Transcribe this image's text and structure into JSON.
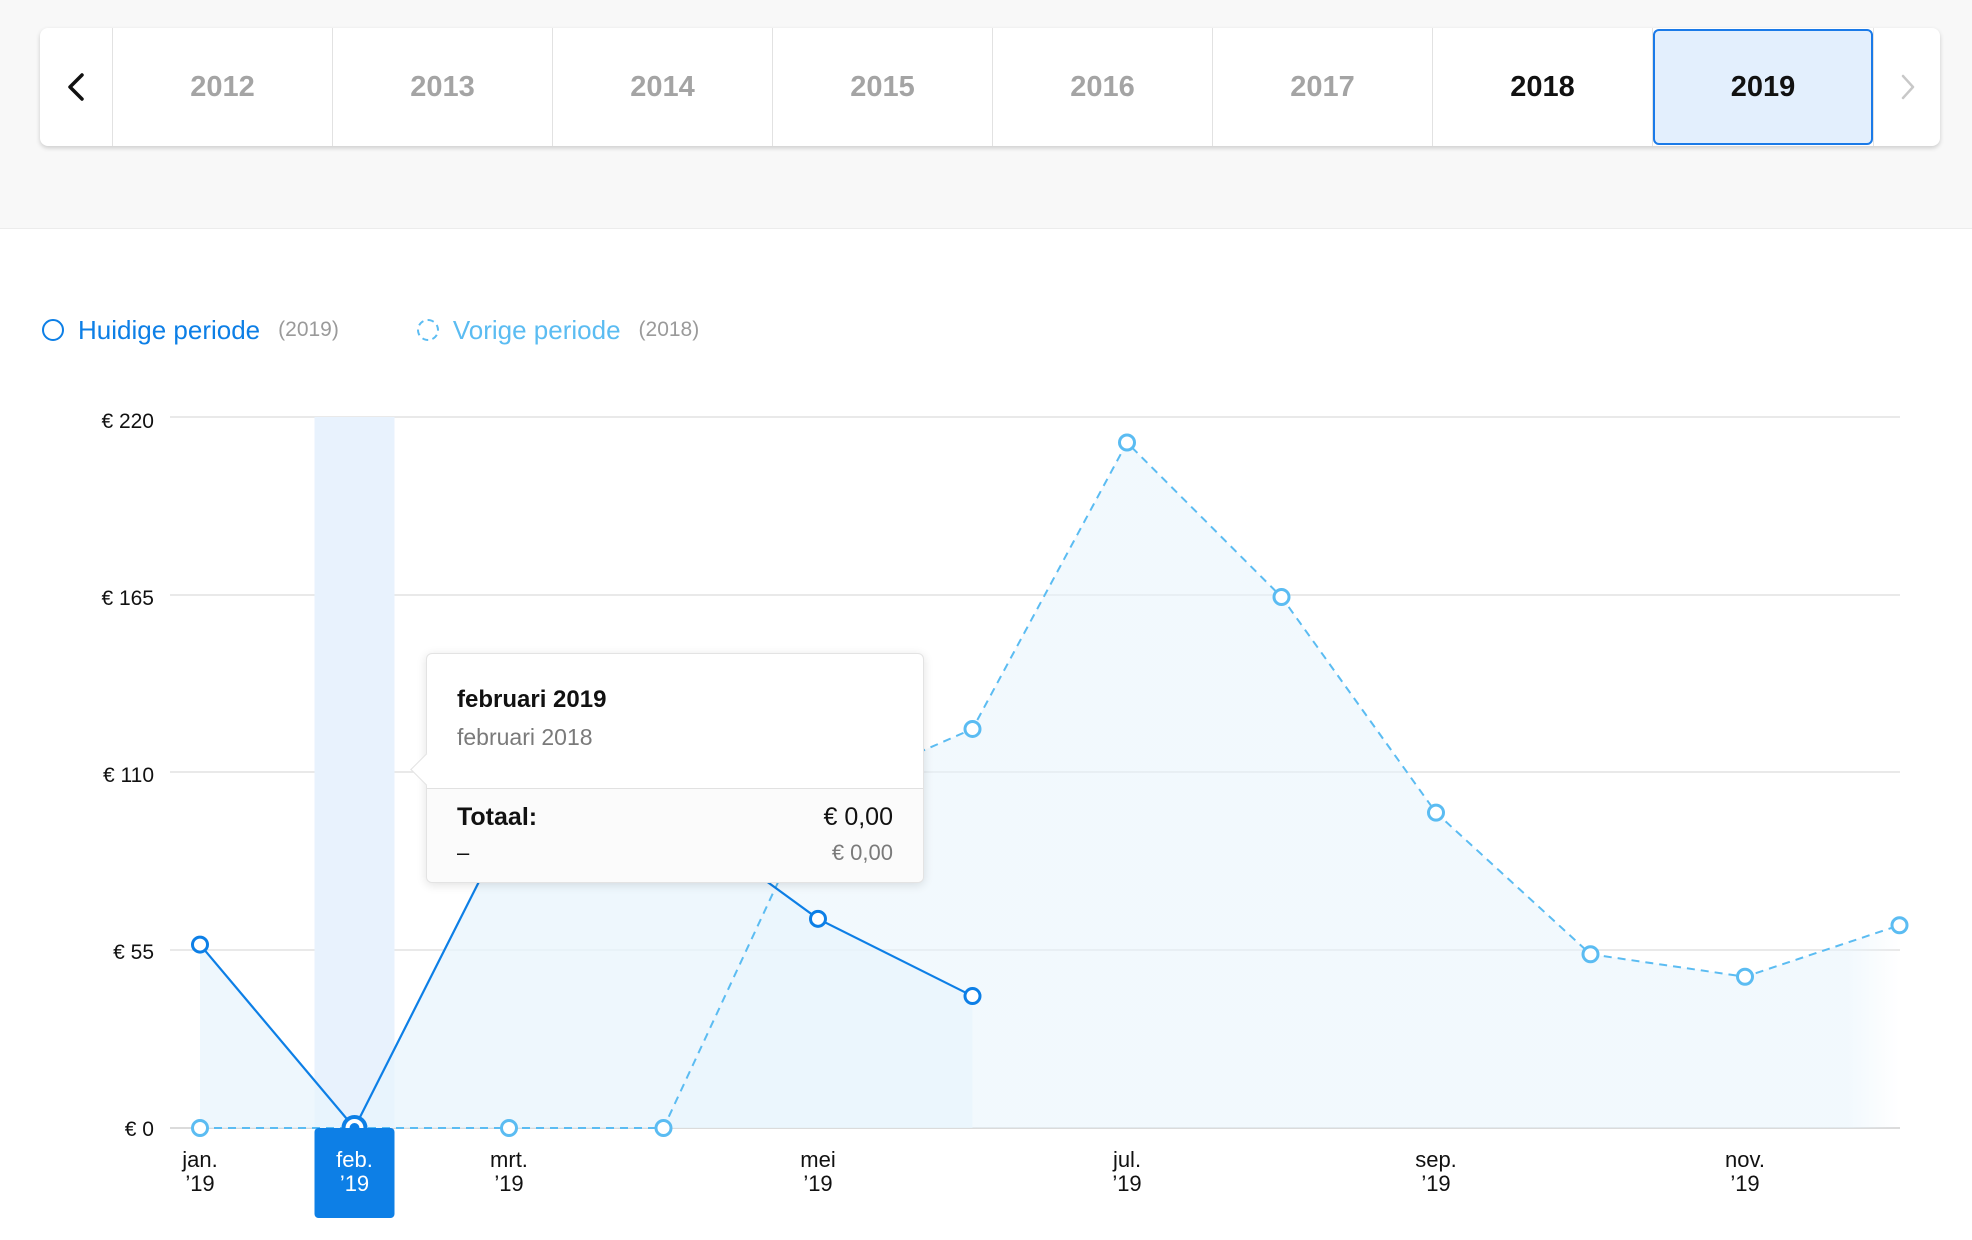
{
  "year_selector": {
    "prev_icon": "chevron-left-icon",
    "next_icon": "chevron-right-icon",
    "years": [
      {
        "label": "2012",
        "state": "dim"
      },
      {
        "label": "2013",
        "state": "dim"
      },
      {
        "label": "2014",
        "state": "dim"
      },
      {
        "label": "2015",
        "state": "dim"
      },
      {
        "label": "2016",
        "state": "dim"
      },
      {
        "label": "2017",
        "state": "dim"
      },
      {
        "label": "2018",
        "state": "bold"
      },
      {
        "label": "2019",
        "state": "selected"
      }
    ]
  },
  "legend": {
    "current": {
      "label": "Huidige periode",
      "year": "(2019)",
      "color": "#0d7fe6"
    },
    "previous": {
      "label": "Vorige periode",
      "year": "(2018)",
      "color": "#5bbcf2"
    }
  },
  "tooltip": {
    "title": "februari 2019",
    "subtitle": "februari 2018",
    "total_label": "Totaal:",
    "total_value": "€ 0,00",
    "prev_label": "–",
    "prev_value": "€ 0,00"
  },
  "chart_data": {
    "type": "line",
    "y_ticks": [
      "€ 0",
      "€ 55",
      "€ 110",
      "€ 165",
      "€ 220"
    ],
    "y_tick_values": [
      0,
      55,
      110,
      165,
      220
    ],
    "ylim": [
      0,
      230
    ],
    "categories": [
      [
        "jan.",
        "’19"
      ],
      [
        "feb.",
        "’19"
      ],
      [
        "mrt.",
        "’19"
      ],
      [
        "",
        ""
      ],
      [
        "mei",
        "’19"
      ],
      [
        "",
        ""
      ],
      [
        "jul.",
        "’19"
      ],
      [
        "",
        ""
      ],
      [
        "sep.",
        "’19"
      ],
      [
        "",
        ""
      ],
      [
        "nov.",
        "’19"
      ],
      [
        "",
        ""
      ]
    ],
    "selected_index": 1,
    "grid": true,
    "legend_position": "top-left",
    "series": [
      {
        "name": "Huidige periode",
        "style": "solid",
        "color": "#0d7fe6",
        "values": [
          57,
          0,
          95,
          100,
          65,
          41
        ]
      },
      {
        "name": "Vorige periode",
        "style": "dashed",
        "color": "#5bbcf2",
        "values": [
          0,
          0,
          0,
          0,
          103,
          124,
          213,
          165,
          98,
          54,
          47,
          63
        ]
      }
    ]
  }
}
